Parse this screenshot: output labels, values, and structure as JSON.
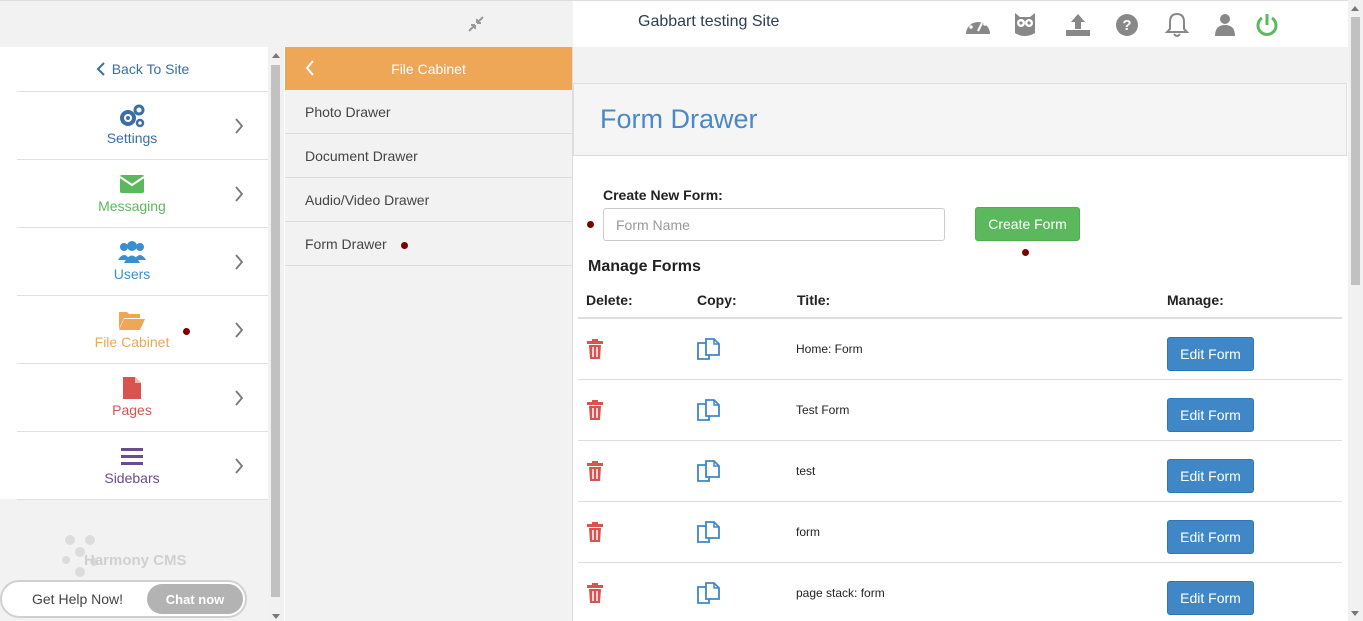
{
  "header": {
    "site_name": "Gabbart testing Site",
    "icons": [
      "dashboard-icon",
      "owl-icon",
      "upload-icon",
      "help-icon",
      "bell-icon",
      "user-icon",
      "power-icon"
    ]
  },
  "sidebar": {
    "back_label": "Back To Site",
    "items": [
      {
        "label": "Settings",
        "icon": "gears-icon",
        "color": "#3a6ea5"
      },
      {
        "label": "Messaging",
        "icon": "envelope-icon",
        "color": "#5cb85c"
      },
      {
        "label": "Users",
        "icon": "users-icon",
        "color": "#3a8fd1"
      },
      {
        "label": "File Cabinet",
        "icon": "folder-open-icon",
        "color": "#eea657"
      },
      {
        "label": "Pages",
        "icon": "file-icon",
        "color": "#d9534f"
      },
      {
        "label": "Sidebars",
        "icon": "bars-icon",
        "color": "#6a4c93"
      }
    ],
    "logo_text": "Harmony CMS"
  },
  "chat": {
    "label": "Get Help Now!",
    "button": "Chat now"
  },
  "file_cabinet": {
    "title": "File Cabinet",
    "drawers": [
      "Photo Drawer",
      "Document Drawer",
      "Audio/Video Drawer",
      "Form Drawer"
    ]
  },
  "main": {
    "page_title": "Form Drawer",
    "new_form_label": "Create New Form:",
    "form_name_placeholder": "Form Name",
    "create_button": "Create Form",
    "manage_title": "Manage Forms",
    "columns": {
      "delete": "Delete:",
      "copy": "Copy:",
      "title": "Title:",
      "manage": "Manage:"
    },
    "forms": [
      {
        "title": "Home: Form",
        "action": "Edit Form"
      },
      {
        "title": "Test Form",
        "action": "Edit Form"
      },
      {
        "title": "test",
        "action": "Edit Form"
      },
      {
        "title": "form",
        "action": "Edit Form"
      },
      {
        "title": "page stack: form",
        "action": "Edit Form"
      }
    ]
  },
  "colors": {
    "accent_orange": "#eea657",
    "primary_blue": "#3f87c7",
    "success_green": "#5cb85c",
    "danger_red": "#d9534f"
  }
}
